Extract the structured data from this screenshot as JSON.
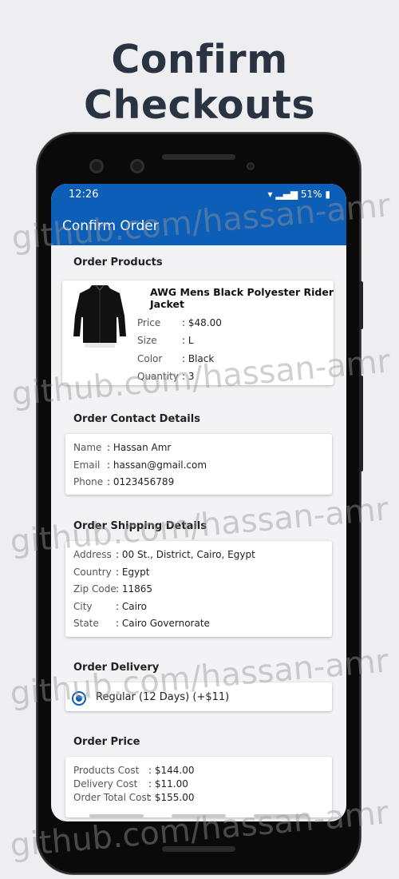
{
  "headline": "Confirm Checkouts",
  "status_bar": {
    "time": "12:26",
    "battery": "51%"
  },
  "app_bar": {
    "title": "Confirm Order"
  },
  "order_products": {
    "title": "Order Products",
    "product": {
      "name": "AWG Mens Black Polyester Rider Jacket",
      "price_label": "Price",
      "price_value": ": $48.00",
      "size_label": "Size",
      "size_value": ": L",
      "color_label": "Color",
      "color_value": ": Black",
      "quantity_label": "Quantity",
      "quantity_value": ": 3"
    }
  },
  "contact": {
    "title": "Order Contact Details",
    "name_label": "Name",
    "name_value": ": Hassan Amr",
    "email_label": "Email",
    "email_value": ": hassan@gmail.com",
    "phone_label": "Phone",
    "phone_value": ": 0123456789"
  },
  "shipping": {
    "title": "Order Shipping Details",
    "address_label": "Address",
    "address_value": ": 00 St., District, Cairo, Egypt",
    "country_label": "Country",
    "country_value": ": Egypt",
    "zip_label": "Zip Code",
    "zip_value": ": 11865",
    "city_label": "City",
    "city_value": ": Cairo",
    "state_label": "State",
    "state_value": ": Cairo Governorate"
  },
  "delivery": {
    "title": "Order Delivery",
    "option": "Regular (12 Days) (+$11)"
  },
  "price": {
    "title": "Order Price",
    "products_label": "Products Cost",
    "products_value": ": $144.00",
    "delivery_label": "Delivery Cost",
    "delivery_value": ": $11.00",
    "total_label": "Order Total Cost",
    "total_value": ": $155.00"
  },
  "watermark": "github.com/hassan-amr",
  "colors": {
    "primary": "#0d5eb6",
    "background": "#eeedf0",
    "headline": "#2a3342"
  }
}
